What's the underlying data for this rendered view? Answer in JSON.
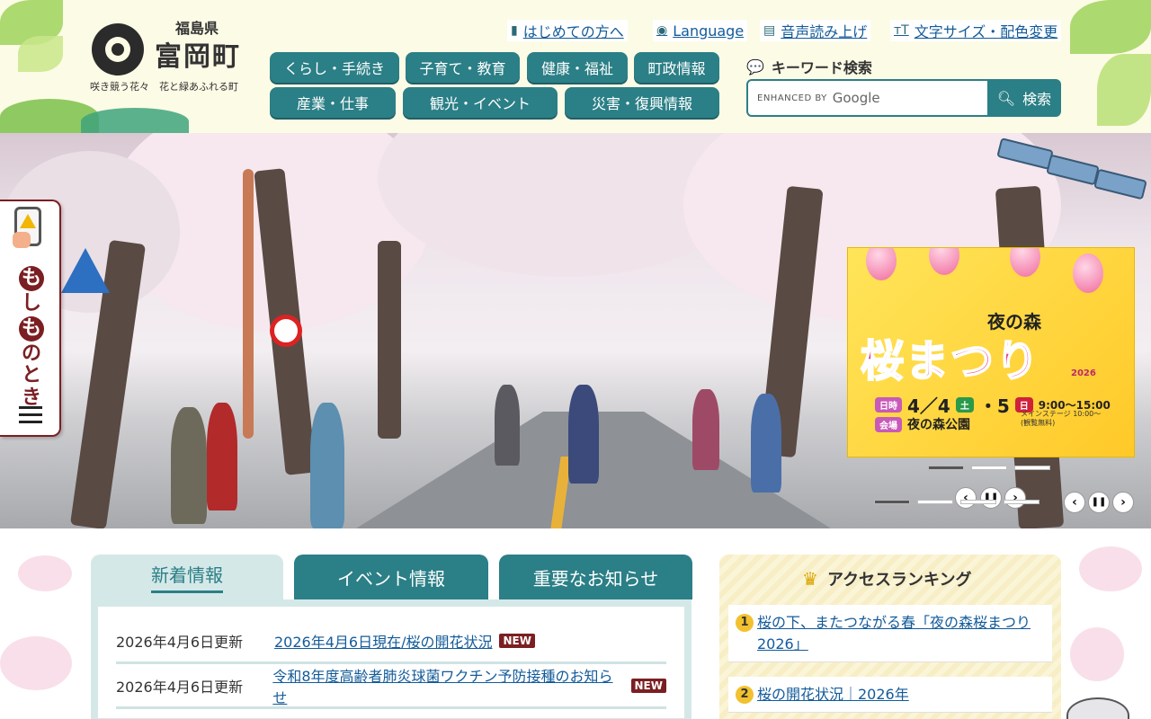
{
  "header": {
    "logo": {
      "prefecture": "福島県",
      "town": "富岡町",
      "tagline": "咲き競う花々　花と緑あふれる町"
    },
    "utility_links": [
      {
        "label": "はじめての方へ",
        "icon": "bookmark-icon"
      },
      {
        "label": "Language",
        "icon": "globe-icon"
      },
      {
        "label": "音声読み上げ",
        "icon": "document-audio-icon"
      },
      {
        "label": "文字サイズ・配色変更",
        "icon": "text-size-icon"
      }
    ],
    "nav": [
      "くらし・手続き",
      "子育て・教育",
      "健康・福祉",
      "町政情報",
      "産業・仕事",
      "観光・イベント",
      "災害・復興情報"
    ],
    "search": {
      "label": "キーワード検索",
      "enhanced": "ENHANCED BY",
      "google": "Google",
      "button": "検索"
    }
  },
  "side_tab": {
    "chars": [
      "も",
      "し",
      "も",
      "の",
      "と",
      "き"
    ]
  },
  "banner": {
    "title_small": "夜の森",
    "title_big": "桜まつり",
    "year": "2026",
    "date_label": "日時",
    "date": "4／4",
    "day1": "土",
    "date2": "・5",
    "day2": "日",
    "time": "9:00〜15:00",
    "stage": "メインステージ 10:00〜",
    "free": "(観覧無料)",
    "venue_label": "会場",
    "venue": "夜の森公園"
  },
  "tabs": [
    {
      "label": "新着情報",
      "active": true
    },
    {
      "label": "イベント情報",
      "active": false
    },
    {
      "label": "重要なお知らせ",
      "active": false
    }
  ],
  "news": [
    {
      "date": "2026年4月6日更新",
      "title": "2026年4月6日現在/桜の開花状況",
      "badge": "NEW"
    },
    {
      "date": "2026年4月6日更新",
      "title": "令和8年度高齢者肺炎球菌ワクチン予防接種のお知らせ",
      "badge": "NEW"
    }
  ],
  "ranking": {
    "title": "アクセスランキング",
    "items": [
      {
        "rank": "1",
        "title": "桜の下、またつながる春「夜の森桜まつり2026」"
      },
      {
        "rank": "2",
        "title": "桜の開花状況｜2026年"
      }
    ]
  },
  "colors": {
    "primary": "#2b7f86",
    "accent": "#7b1f22",
    "link": "#135b9a",
    "header_bg": "#fcfbe6"
  }
}
